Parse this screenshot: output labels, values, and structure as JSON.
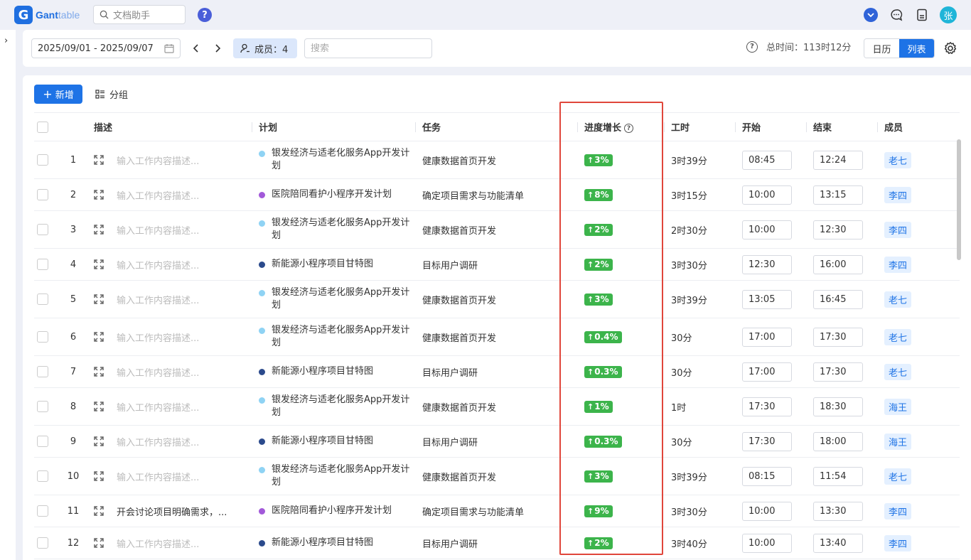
{
  "app": {
    "logo_letter": "G",
    "name_bold": "Gant",
    "name_light": "table",
    "assistant_label": "文档助手",
    "help_glyph": "?",
    "avatar_initial": "张"
  },
  "filter": {
    "date_range": "2025/09/01 - 2025/09/07",
    "members_label": "成员：4",
    "search_placeholder": "搜索",
    "total_label": "总时间：",
    "total_value": "113时12分",
    "view_calendar": "日历",
    "view_list": "列表"
  },
  "toolbar": {
    "add_label": "新增",
    "group_label": "分组"
  },
  "columns": {
    "desc": "描述",
    "plan": "计划",
    "task": "任务",
    "progress": "进度增长",
    "hours": "工时",
    "start": "开始",
    "end": "结束",
    "member": "成员"
  },
  "colors": {
    "accent": "#1e73e6",
    "progress_badge": "#3cb44b",
    "highlight_box": "#e0463b",
    "plan_light_blue": "#8fd3f4",
    "plan_purple": "#a259d9",
    "plan_navy": "#2b4a8c"
  },
  "rows": [
    {
      "no": "1",
      "desc": "输入工作内容描述...",
      "plan": "银发经济与适老化服务App开发计划",
      "plan_color": "#8fd3f4",
      "task": "健康数据首页开发",
      "progress": "3%",
      "hours": "3时39分",
      "start": "08:45",
      "end": "12:24",
      "member": "老七"
    },
    {
      "no": "2",
      "desc": "输入工作内容描述...",
      "plan": "医院陪同看护小程序开发计划",
      "plan_color": "#a259d9",
      "task": "确定项目需求与功能清单",
      "progress": "8%",
      "hours": "3时15分",
      "start": "10:00",
      "end": "13:15",
      "member": "李四"
    },
    {
      "no": "3",
      "desc": "输入工作内容描述...",
      "plan": "银发经济与适老化服务App开发计划",
      "plan_color": "#8fd3f4",
      "task": "健康数据首页开发",
      "progress": "2%",
      "hours": "2时30分",
      "start": "10:00",
      "end": "12:30",
      "member": "李四"
    },
    {
      "no": "4",
      "desc": "输入工作内容描述...",
      "plan": "新能源小程序项目甘特图",
      "plan_color": "#2b4a8c",
      "task": "目标用户调研",
      "progress": "2%",
      "hours": "3时30分",
      "start": "12:30",
      "end": "16:00",
      "member": "李四"
    },
    {
      "no": "5",
      "desc": "输入工作内容描述...",
      "plan": "银发经济与适老化服务App开发计划",
      "plan_color": "#8fd3f4",
      "task": "健康数据首页开发",
      "progress": "3%",
      "hours": "3时39分",
      "start": "13:05",
      "end": "16:45",
      "member": "老七"
    },
    {
      "no": "6",
      "desc": "输入工作内容描述...",
      "plan": "银发经济与适老化服务App开发计划",
      "plan_color": "#8fd3f4",
      "task": "健康数据首页开发",
      "progress": "0.4%",
      "hours": "30分",
      "start": "17:00",
      "end": "17:30",
      "member": "老七"
    },
    {
      "no": "7",
      "desc": "输入工作内容描述...",
      "plan": "新能源小程序项目甘特图",
      "plan_color": "#2b4a8c",
      "task": "目标用户调研",
      "progress": "0.3%",
      "hours": "30分",
      "start": "17:00",
      "end": "17:30",
      "member": "老七"
    },
    {
      "no": "8",
      "desc": "输入工作内容描述...",
      "plan": "银发经济与适老化服务App开发计划",
      "plan_color": "#8fd3f4",
      "task": "健康数据首页开发",
      "progress": "1%",
      "hours": "1时",
      "start": "17:30",
      "end": "18:30",
      "member": "海王"
    },
    {
      "no": "9",
      "desc": "输入工作内容描述...",
      "plan": "新能源小程序项目甘特图",
      "plan_color": "#2b4a8c",
      "task": "目标用户调研",
      "progress": "0.3%",
      "hours": "30分",
      "start": "17:30",
      "end": "18:00",
      "member": "海王"
    },
    {
      "no": "10",
      "desc": "输入工作内容描述...",
      "plan": "银发经济与适老化服务App开发计划",
      "plan_color": "#8fd3f4",
      "task": "健康数据首页开发",
      "progress": "3%",
      "hours": "3时39分",
      "start": "08:15",
      "end": "11:54",
      "member": "老七"
    },
    {
      "no": "11",
      "desc": "开会讨论项目明确需求，...",
      "desc_filled": true,
      "plan": "医院陪同看护小程序开发计划",
      "plan_color": "#a259d9",
      "task": "确定项目需求与功能清单",
      "progress": "9%",
      "hours": "3时30分",
      "start": "10:00",
      "end": "13:30",
      "member": "李四"
    },
    {
      "no": "12",
      "desc": "输入工作内容描述...",
      "plan": "新能源小程序项目甘特图",
      "plan_color": "#2b4a8c",
      "task": "目标用户调研",
      "progress": "2%",
      "hours": "3时40分",
      "start": "10:00",
      "end": "13:40",
      "member": "李四"
    }
  ]
}
